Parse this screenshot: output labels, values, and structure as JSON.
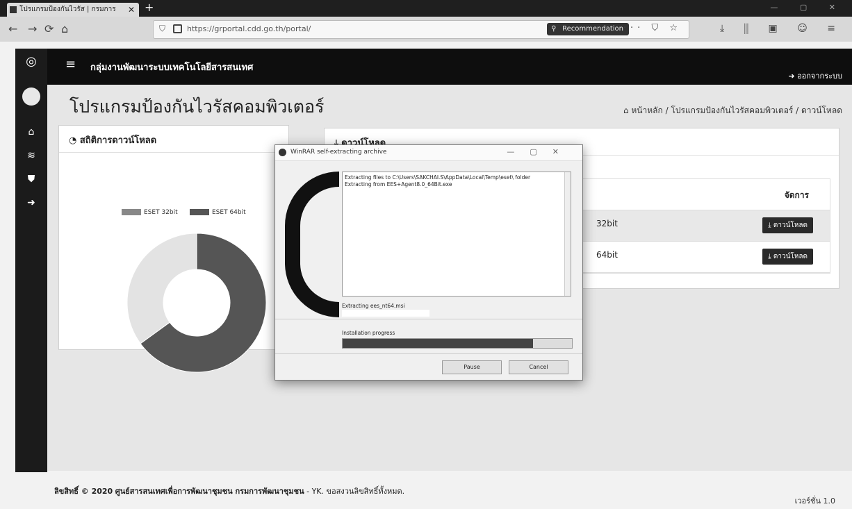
{
  "browser": {
    "tab_title": "โปรแกรมป้องกันไวรัส | กรมการ",
    "tab_close": "✕",
    "new_tab": "+",
    "url": "https://grportal.cdd.go.th/portal/",
    "recommendation": "Recommendation",
    "url_icons": "··· ⛉ ☆",
    "right_icons": "⤓ ⫼ ▣ ☺ ≡",
    "win_controls": "— ▢ ✕",
    "nav_back": "←",
    "nav_forward": "→",
    "nav_reload": "⟳",
    "nav_home": "⌂"
  },
  "app": {
    "site_title": "กลุ่มงานพัฒนาระบบเทคโนโลยีสารสนเทศ",
    "logout": "ออกจากระบบ",
    "page_title": "โปรแกรมป้องกันไวรัสคอมพิวเตอร์",
    "breadcrumb": "หน้าหลัก / โปรแกรมป้องกันไวรัสคอมพิวเตอร์ / ดาวน์โหลด",
    "stats_card_title": "สถิติการดาวน์โหลด",
    "download_card_title": "ดาวน์โหลด",
    "table_action_header": "จัดการ",
    "rows": [
      {
        "name": "32bit",
        "button": "ดาวน์โหลด"
      },
      {
        "name": "64bit",
        "button": "ดาวน์โหลด"
      }
    ]
  },
  "chart_data": {
    "type": "pie",
    "legend_position": "top",
    "series": [
      {
        "name": "ESET 32bit",
        "value": 35,
        "color": "#e3e3e3"
      },
      {
        "name": "ESET 64bit",
        "value": 65,
        "color": "#555555"
      }
    ]
  },
  "dialog": {
    "title": "WinRAR self-extracting archive",
    "log_lines": [
      "Extracting files to C:\\Users\\SAKCHAI.S\\AppData\\Local\\Temp\\eset\\ folder",
      "Extracting from EES+Agent8.0_64Bit.exe"
    ],
    "status": "Extracting ees_nt64.msi",
    "progress_label": "Installation progress",
    "progress": 0.83,
    "pause": "Pause",
    "cancel": "Cancel"
  },
  "footer": {
    "copyright_prefix": "ลิขสิทธิ์ © 2020",
    "org": "ศูนย์สารสนเทศเพื่อการพัฒนาชุมชน กรมการพัฒนาชุมชน",
    "suffix": "- YK. ขอสงวนลิขสิทธิ์ทั้งหมด.",
    "version": "เวอร์ชั่น 1.0"
  }
}
